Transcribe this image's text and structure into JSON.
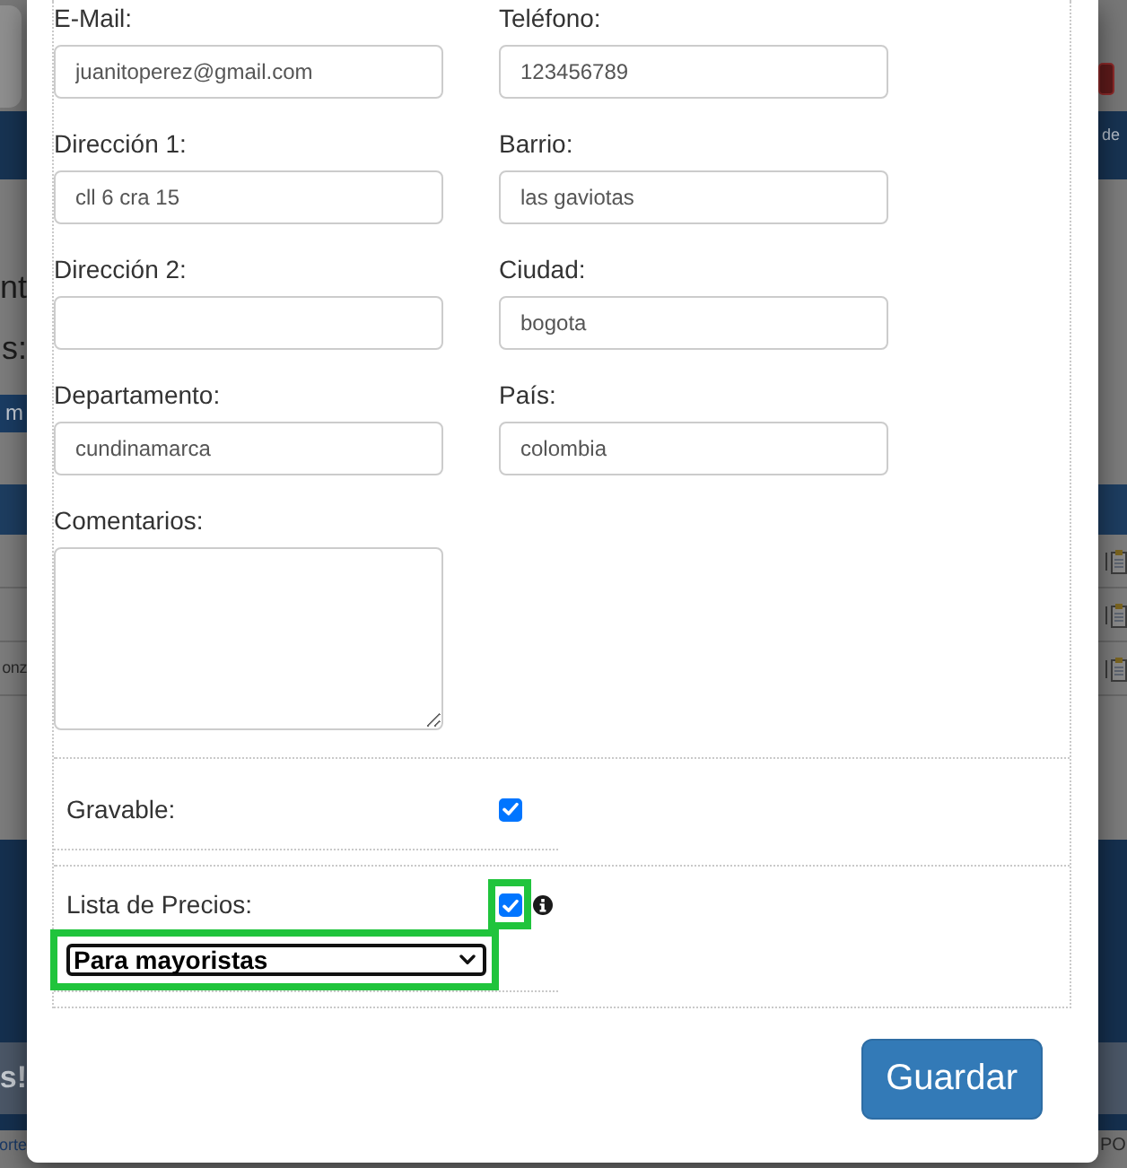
{
  "form": {
    "fields": [
      {
        "kind": "input",
        "label": "E-Mail:",
        "value": "juanitoperez@gmail.com"
      },
      {
        "kind": "input",
        "label": "Teléfono:",
        "value": "123456789"
      },
      {
        "kind": "input",
        "label": "Dirección 1:",
        "value": "cll 6 cra 15"
      },
      {
        "kind": "input",
        "label": "Barrio:",
        "value": "las gaviotas"
      },
      {
        "kind": "input",
        "label": "Dirección 2:"
      },
      {
        "kind": "input",
        "label": "Ciudad:",
        "value": "bogota"
      },
      {
        "kind": "input",
        "label": "Departamento:",
        "value": "cundinamarca"
      },
      {
        "kind": "input",
        "label": "País:",
        "value": "colombia"
      },
      {
        "kind": "textarea",
        "label": "Comentarios:"
      }
    ],
    "options": [
      {
        "kind": "checkbox",
        "label": "Gravable:",
        "checked": true,
        "highlighted": false
      },
      {
        "kind": "checkbox_select",
        "label": "Lista de Precios:",
        "checked": true,
        "highlighted": true,
        "select": {
          "value": "Para mayoristas",
          "highlighted": true
        }
      }
    ]
  },
  "footer": {
    "buttons": [
      {
        "kind": "primary",
        "label": "Guardar"
      }
    ]
  },
  "background": {
    "nav_label": "de",
    "heading": "nt",
    "subheading": "s:",
    "button_label": "m",
    "table_cell": "onz",
    "banner": "s!",
    "footer_link": "orte",
    "footer_text": "PO"
  }
}
